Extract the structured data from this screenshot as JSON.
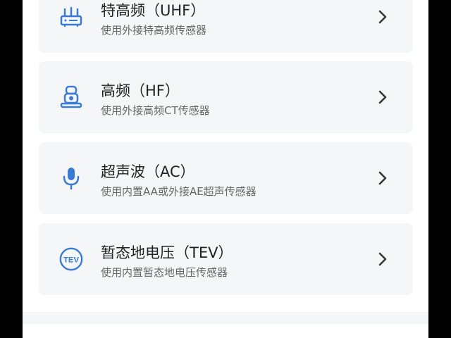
{
  "colors": {
    "accent": "#3a7bd5",
    "card_bg": "#f5f6f8",
    "title": "#222222",
    "subtitle": "#666666",
    "chevron": "#333333"
  },
  "sensors": [
    {
      "title": "特高频（UHF）",
      "subtitle": "使用外接特高频传感器",
      "icon": "router-icon"
    },
    {
      "title": "高频（HF）",
      "subtitle": "使用外接高频CT传感器",
      "icon": "sensor-device-icon"
    },
    {
      "title": "超声波（AC）",
      "subtitle": "使用内置AA或外接AE超声传感器",
      "icon": "microphone-icon"
    },
    {
      "title": "暂态地电压（TEV）",
      "subtitle": "使用内置暂态地电压传感器",
      "icon": "tev-badge-icon",
      "icon_text": "TEV"
    }
  ]
}
